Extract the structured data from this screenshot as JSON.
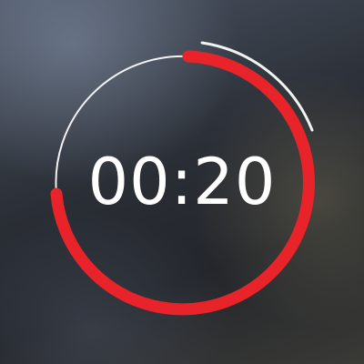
{
  "timer": {
    "time_display": "00:20",
    "colors": {
      "elapsed_arc": "#e8242a",
      "remaining_track": "#f2f2f2",
      "text": "#ffffff"
    }
  }
}
